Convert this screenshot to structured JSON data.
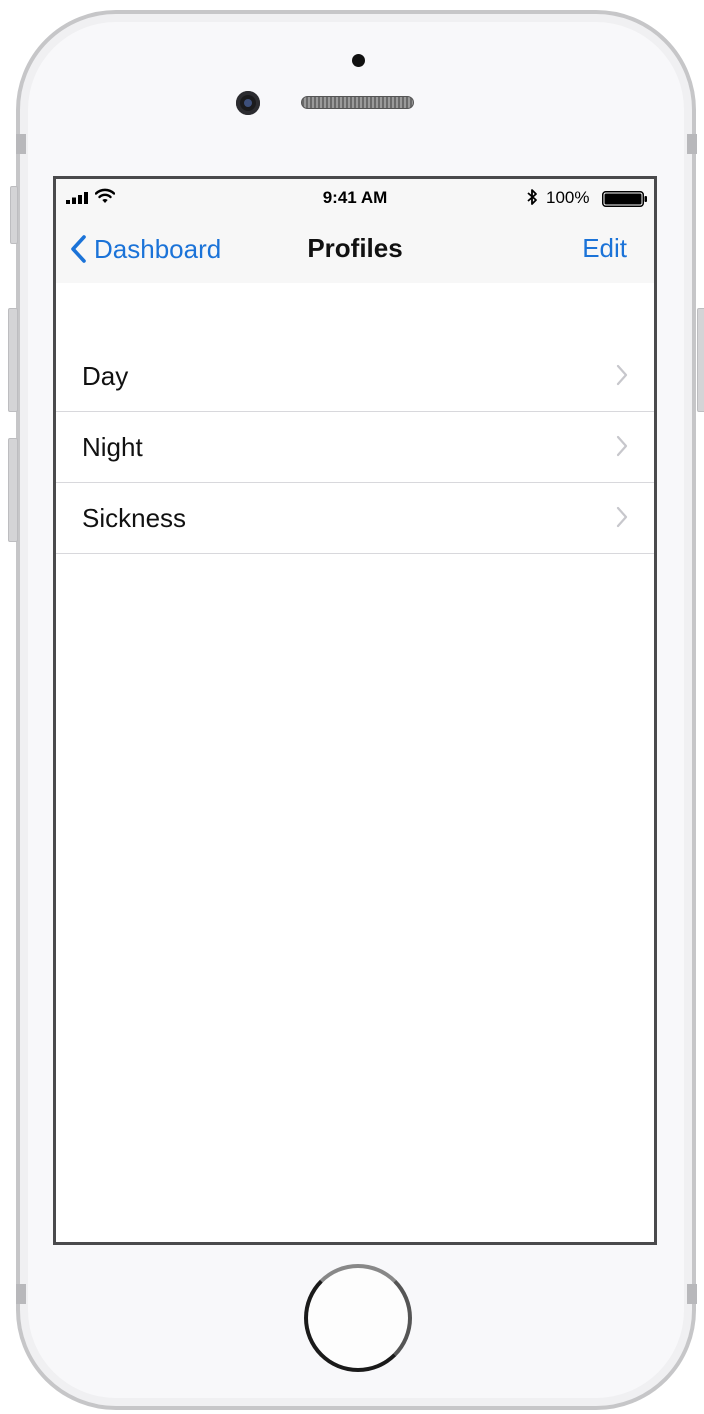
{
  "status_bar": {
    "time": "9:41 AM",
    "battery_percent": "100%",
    "signal_icon": "cellular-signal-icon",
    "wifi_icon": "wifi-icon",
    "bluetooth_icon": "bluetooth-icon",
    "battery_icon": "battery-icon",
    "battery_level": 1.0
  },
  "nav_bar": {
    "back_label": "Dashboard",
    "title": "Profiles",
    "edit_label": "Edit",
    "back_icon": "chevron-left-icon"
  },
  "profiles": {
    "items": [
      {
        "label": "Day"
      },
      {
        "label": "Night"
      },
      {
        "label": "Sickness"
      }
    ],
    "row_icon": "chevron-right-icon"
  },
  "colors": {
    "accent": "#1b73d8",
    "nav_background": "#f7f7f7",
    "separator": "#d8d8dc",
    "chevron": "#c7c7cc"
  }
}
